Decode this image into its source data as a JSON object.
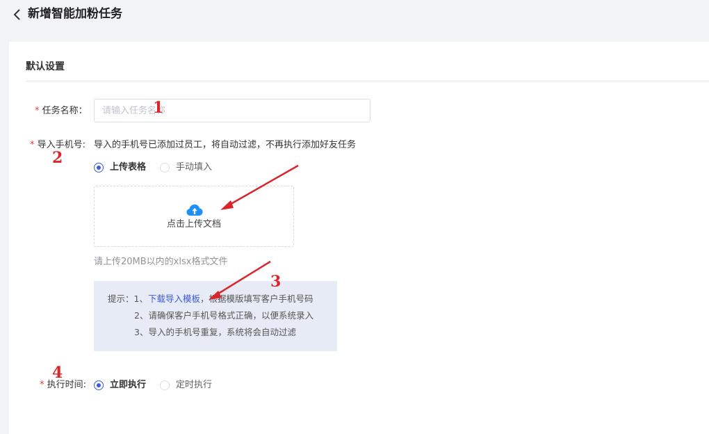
{
  "header": {
    "title": "新增智能加粉任务"
  },
  "section": {
    "title": "默认设置"
  },
  "form": {
    "task_name": {
      "required_mark": "*",
      "label": "任务名称：",
      "placeholder": "请输入任务名称",
      "value": ""
    },
    "import_phone": {
      "required_mark": "*",
      "label": "导入手机号:",
      "hint": "导入的手机号已添加过员工，将自动过滤，不再执行添加好友任务",
      "options": [
        {
          "label": "上传表格",
          "checked": true
        },
        {
          "label": "手动填入",
          "checked": false
        }
      ],
      "upload_label": "点击上传文档",
      "file_tip": "请上传20MB以内的xlsx格式文件",
      "tips": {
        "prefix": "提示：1、",
        "link": "下载导入模板",
        "line1_rest": "，根据模版填写客户手机号码",
        "line2": "2、请确保客户手机号格式正确，以便系统录入",
        "line3": "3、导入的手机号重复，系统将会自动过滤"
      }
    },
    "exec_time": {
      "required_mark": "*",
      "label": "执行时间:",
      "options": [
        {
          "label": "立即执行",
          "checked": true
        },
        {
          "label": "定时执行",
          "checked": false
        }
      ]
    }
  },
  "annotations": {
    "color": "#d9262c",
    "marks": [
      "1",
      "2",
      "3",
      "4"
    ]
  },
  "colors": {
    "accent": "#3b5bdb",
    "required": "#e8383d",
    "upload_icon": "#1e8ff7",
    "tips_bg": "#e6ebf6"
  }
}
